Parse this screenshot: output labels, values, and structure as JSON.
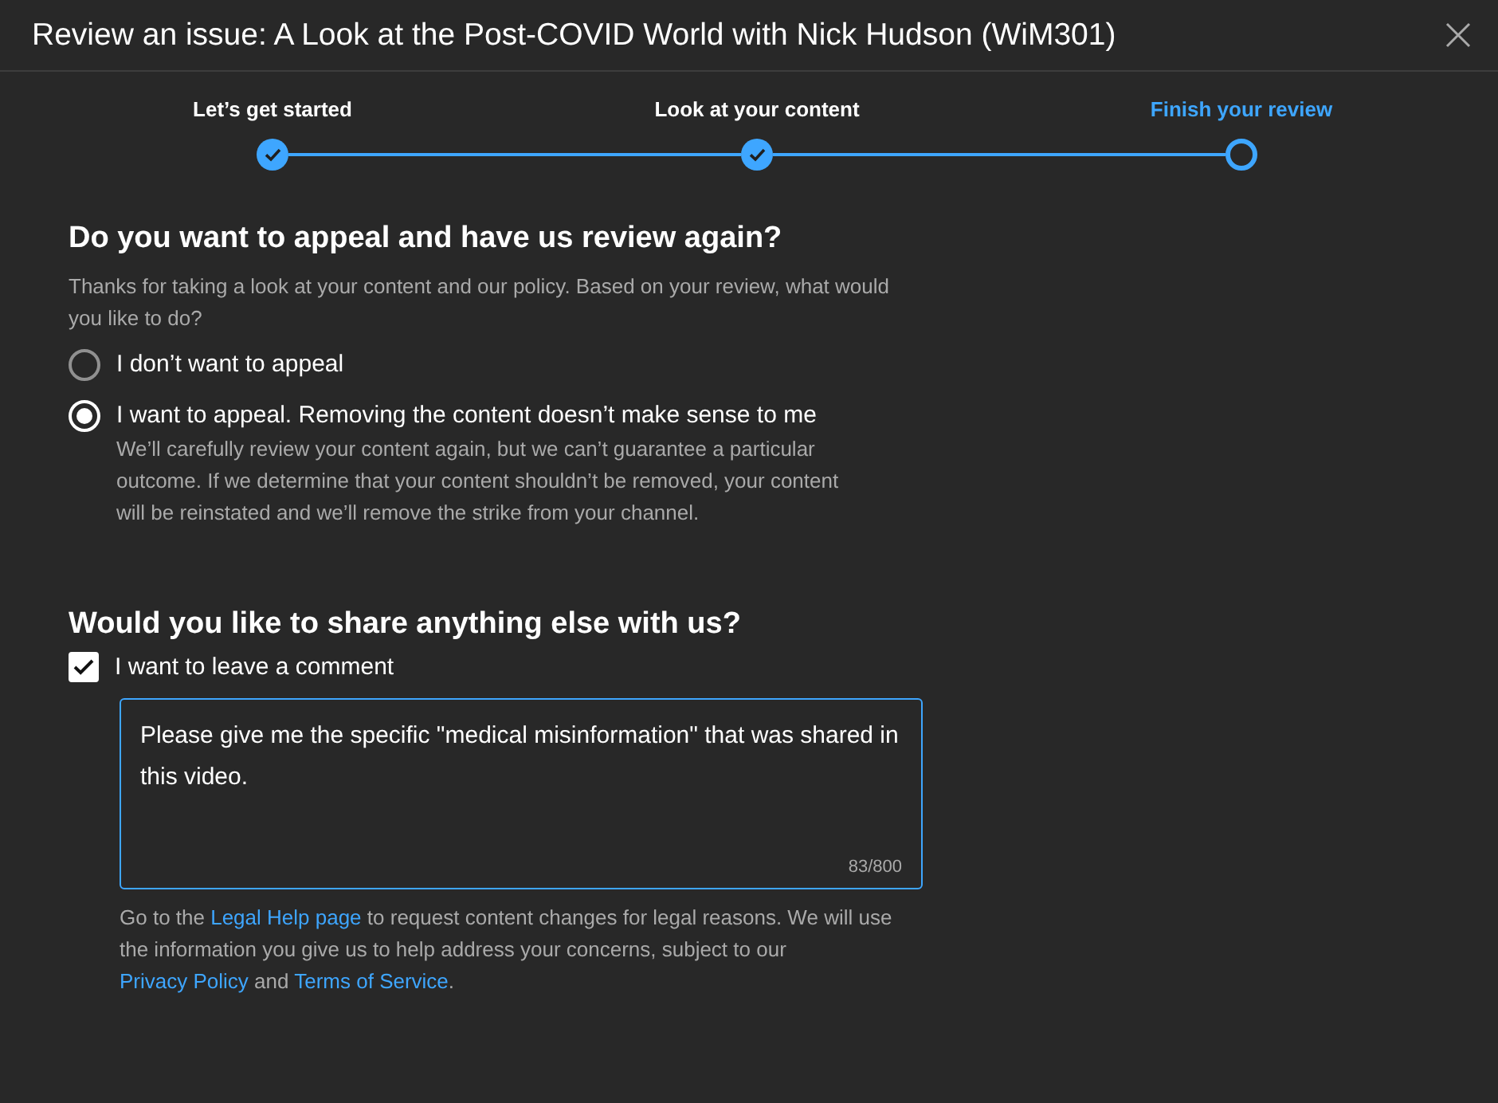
{
  "window": {
    "title": "Review an issue: A Look at the Post-COVID World with Nick Hudson (WiM301)"
  },
  "stepper": {
    "steps": [
      {
        "label": "Let’s get started",
        "completed": true,
        "selected": false
      },
      {
        "label": "Look at your content",
        "completed": true,
        "selected": false
      },
      {
        "label": "Finish your review",
        "completed": false,
        "selected": true
      }
    ]
  },
  "appeal": {
    "heading": "Do you want to appeal and have us review again?",
    "description": "Thanks for taking a look at your content and our policy. Based on your review, what would you like to do?",
    "options": [
      {
        "label": "I don’t want to appeal",
        "selected": false
      },
      {
        "label": "I want to appeal. Removing the content doesn’t make sense to me",
        "selected": true,
        "detail": "We’ll carefully review your content again, but we can’t guarantee a particular outcome. If we determine that your content shouldn’t be removed, your content will be reinstated and we’ll remove the strike from your channel."
      }
    ]
  },
  "comment": {
    "heading": "Would you like to share anything else with us?",
    "checkbox": {
      "label": "I want to leave a comment",
      "checked": true
    },
    "field": {
      "value": "Please give me the specific \"medical misinformation\" that was shared in this video.",
      "counter": "83/800"
    },
    "footnote": [
      {
        "kind": "text",
        "text": "Go to the "
      },
      {
        "kind": "link",
        "text": "Legal Help page"
      },
      {
        "kind": "text",
        "text": " to request content changes for legal reasons. We will use the information you give us to help address your concerns, subject to our "
      },
      {
        "kind": "link",
        "text": "Privacy Policy"
      },
      {
        "kind": "text",
        "text": " and "
      },
      {
        "kind": "link",
        "text": "Terms of Service"
      },
      {
        "kind": "text",
        "text": "."
      }
    ]
  }
}
